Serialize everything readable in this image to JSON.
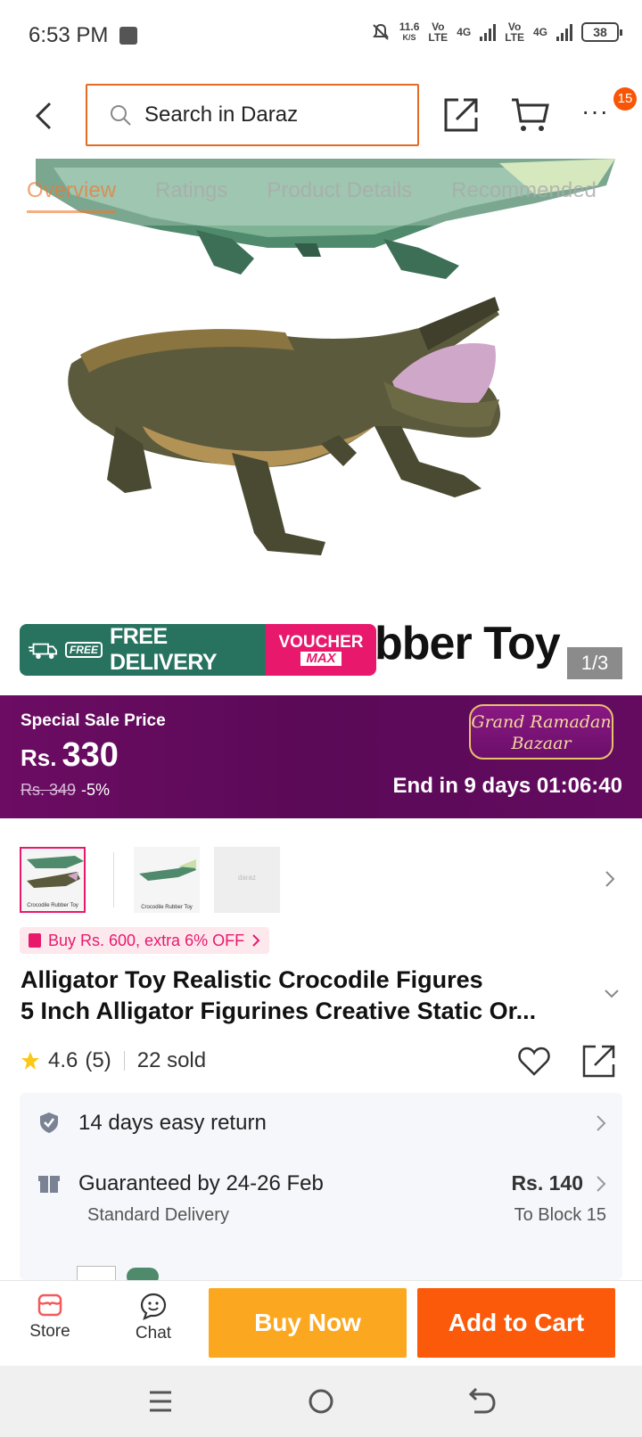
{
  "status_bar": {
    "time": "6:53 PM",
    "net_speed_value": "11.6",
    "net_speed_unit": "K/S",
    "sim1_tech": "Vo",
    "sim1_sub": "LTE",
    "sim1_gen": "4G",
    "sim2_tech": "Vo",
    "sim2_sub": "LTE",
    "sim2_gen": "4G",
    "battery": "38"
  },
  "header": {
    "search_placeholder": "Search in Daraz",
    "cart_badge": "15"
  },
  "hero": {
    "tabs": [
      "Overview",
      "Ratings",
      "Product Details",
      "Recommended"
    ],
    "active_tab_index": 0,
    "image_caption": "bber Toy",
    "page_indicator": "1/3",
    "promo_free_tag": "FREE",
    "promo_free_label": "FREE DELIVERY",
    "promo_voucher_line1": "VOUCHER",
    "promo_voucher_line2": "MAX"
  },
  "sale": {
    "label": "Special Sale Price",
    "currency": "Rs.",
    "price": "330",
    "original_price": "Rs. 349",
    "discount": "-5%",
    "campaign_line1": "Grand Ramadan",
    "campaign_line2": "Bazaar",
    "countdown": "End in 9 days 01:06:40"
  },
  "thumbnails": {
    "caption": "Crocodile Rubber Toy",
    "placeholder_text": "daraz",
    "selected_index": 0
  },
  "deal": {
    "text": "Buy Rs. 600, extra 6% OFF"
  },
  "product": {
    "title_line1": "Alligator Toy Realistic Crocodile Figures",
    "title_line2": "5 Inch Alligator Figurines Creative Static Or...",
    "rating": "4.6",
    "rating_count": "(5)",
    "sold": "22 sold"
  },
  "info": {
    "return_text": "14 days easy return",
    "delivery_text": "Guaranteed by 24-26 Feb",
    "delivery_sub": "Standard Delivery",
    "delivery_price": "Rs. 140",
    "delivery_dest": "To Block 15"
  },
  "actions": {
    "store_label": "Store",
    "chat_label": "Chat",
    "buy_now": "Buy Now",
    "add_to_cart": "Add to Cart"
  },
  "colors": {
    "brand_orange": "#f85606",
    "buy_now": "#fba820",
    "add_to_cart": "#fa5a0a",
    "sale_purple": "#6c0c63",
    "accent_pink": "#e8196d"
  }
}
